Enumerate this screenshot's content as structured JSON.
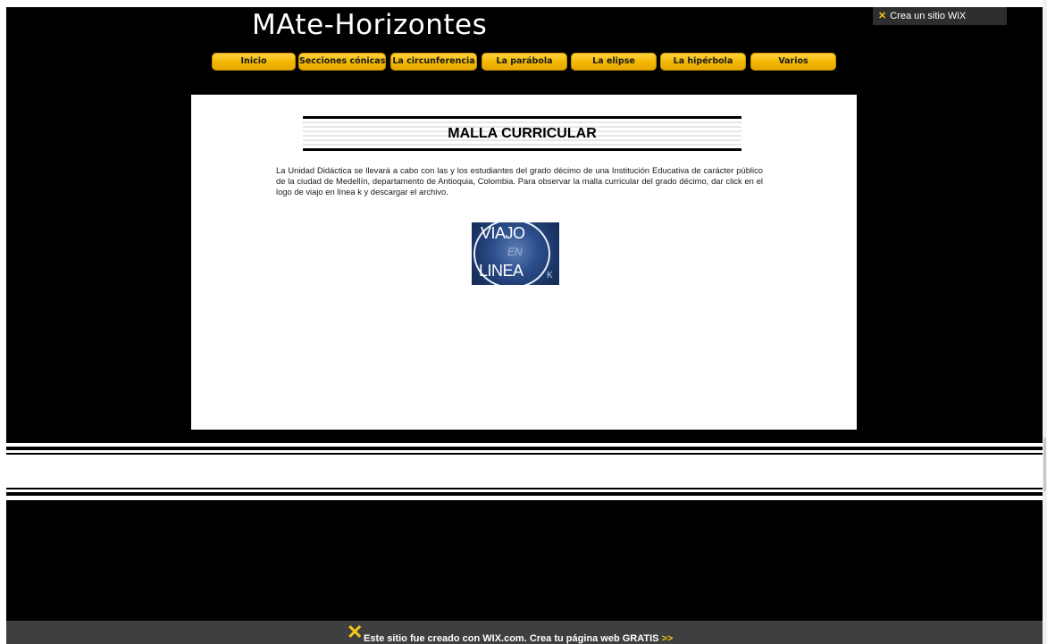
{
  "site": {
    "title": "MAte-Horizontes"
  },
  "wix_promo": {
    "icon": "wix-x-icon",
    "label": "Crea un sitio WiX"
  },
  "nav": {
    "items": [
      {
        "label": "Inicio"
      },
      {
        "label": "Secciones cónicas"
      },
      {
        "label": "La circunferencia"
      },
      {
        "label": "La parábola"
      },
      {
        "label": "La elipse"
      },
      {
        "label": "La hipérbola"
      },
      {
        "label": "Varios"
      }
    ]
  },
  "main": {
    "heading": "MALLA CURRICULAR",
    "intro": "La Unidad Didáctica se llevará a cabo con las y los estudiantes del grado décimo de una Institución Educativa de carácter público  de la ciudad de Medellín, departamento de Antioquia, Colombia.  Para observar la malla curricular del grado décimo, dar click en el logo de viajo en línea k y descargar el archivo.",
    "logo": {
      "line1": "VIAJO",
      "line2": "EN",
      "line3": "LINEA",
      "line4": "K"
    }
  },
  "footer": {
    "icon": "wix-x-icon",
    "text": "Este sitio fue creado con WIX.com. Crea tu página web GRATIS",
    "arrows": ">>"
  },
  "colors": {
    "background": "#000000",
    "nav_button": "#f2b600",
    "footer_bar": "#3f3f3f",
    "wix_accent": "#f5c518"
  }
}
